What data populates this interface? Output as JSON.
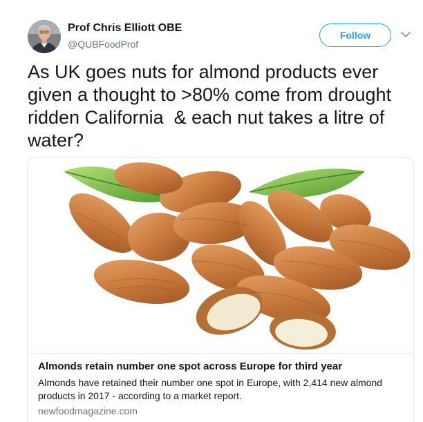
{
  "author": {
    "display_name": "Prof Chris Elliott OBE",
    "handle": "@QUBFoodProf",
    "avatar_icon": "profile-photo"
  },
  "actions": {
    "follow_label": "Follow",
    "more_icon": "chevron-down-icon"
  },
  "tweet": {
    "text": "As UK goes nuts for almond products ever given a thought to >80% come from drought ridden California  & each nut takes a litre of water?"
  },
  "link_card": {
    "image_icon": "almonds-photo",
    "title": "Almonds retain number one spot across Europe for third year",
    "description": "Almonds have retained their number one spot in Europe, with 2,414 new almond products in 2017 - according to a market report.",
    "domain": "newfoodmagazine.com"
  },
  "colors": {
    "accent": "#1da1f2",
    "text": "#14171a",
    "secondary_text": "#657786",
    "border": "#e1e8ed"
  }
}
